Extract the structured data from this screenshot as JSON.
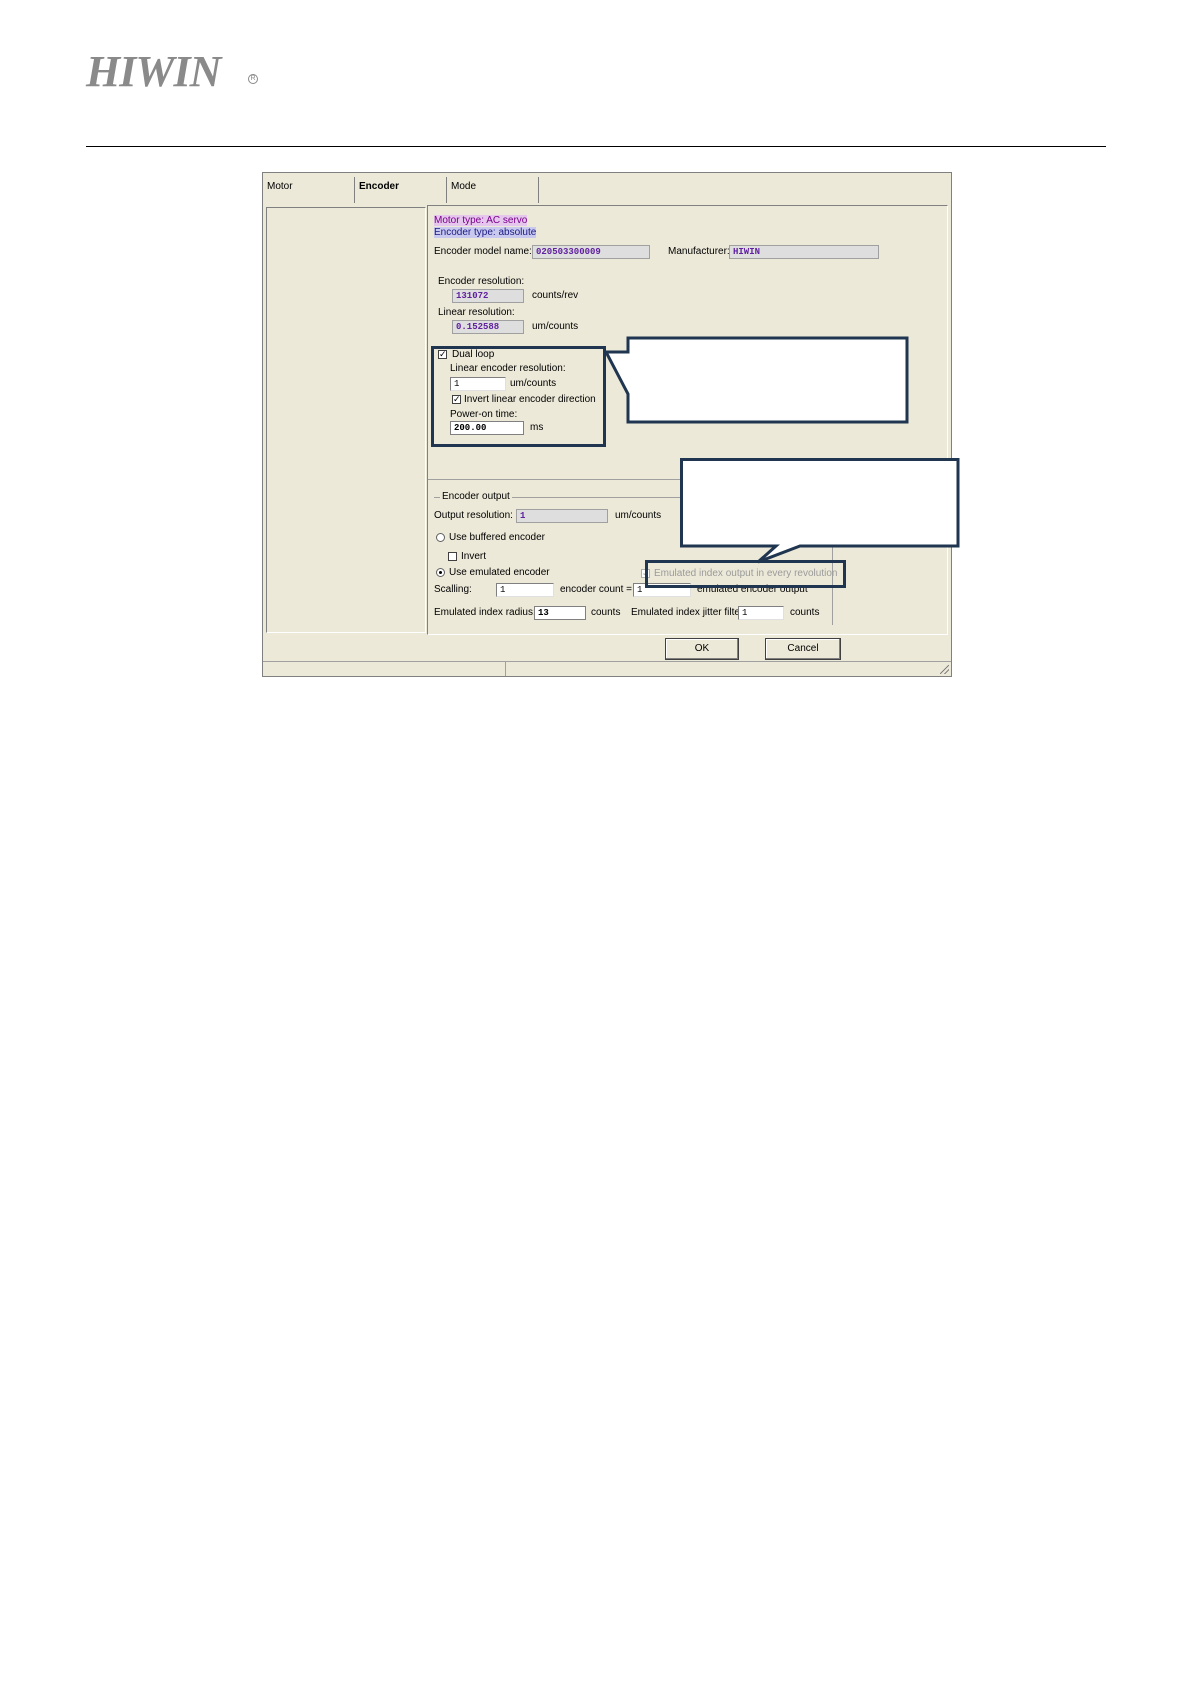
{
  "header": {
    "brand": "HIWIN",
    "reg_mark": "R"
  },
  "tabs": [
    "Motor",
    "Encoder",
    "Mode"
  ],
  "info": {
    "motor_type": "Motor type: AC servo",
    "encoder_type": "Encoder type: absolute"
  },
  "encoder_model": {
    "label": "Encoder model name:",
    "value": "020503300009"
  },
  "manufacturer": {
    "label": "Manufacturer:",
    "value": "HIWIN"
  },
  "encoder_resolution": {
    "label": "Encoder resolution:",
    "value": "131072",
    "unit": "counts/rev"
  },
  "linear_resolution": {
    "label": "Linear resolution:",
    "value": "0.152588",
    "unit": "um/counts"
  },
  "dual_loop": {
    "label": "Dual loop",
    "checked": true,
    "linear_enc_res_label": "Linear encoder resolution:",
    "linear_enc_res_value": "1",
    "linear_enc_res_unit": "um/counts",
    "invert_label": "Invert linear encoder direction",
    "power_on_label": "Power-on time:",
    "power_on_value": "200.00",
    "power_on_unit": "ms"
  },
  "encoder_output": {
    "group_label": "Encoder output",
    "output_res_label": "Output resolution:",
    "output_res_value": "1",
    "output_res_unit": "um/counts",
    "buffered_label": "Use buffered encoder",
    "invert_label": "Invert",
    "emulated_label": "Use emulated encoder",
    "emulated_index_label": "Emulated index output in every revolution",
    "scaling_label": "Scalling:",
    "scaling_value": "1",
    "encoder_count_label": "encoder count =",
    "encoder_count_value": "1",
    "emulated_output_label": "emulated encoder output",
    "index_radius_label": "Emulated index radius:",
    "index_radius_value": "13",
    "index_radius_unit": "counts",
    "jitter_label": "Emulated index jitter filter:",
    "jitter_value": "1",
    "jitter_unit": "counts"
  },
  "buttons": {
    "ok": "OK",
    "cancel": "Cancel"
  }
}
